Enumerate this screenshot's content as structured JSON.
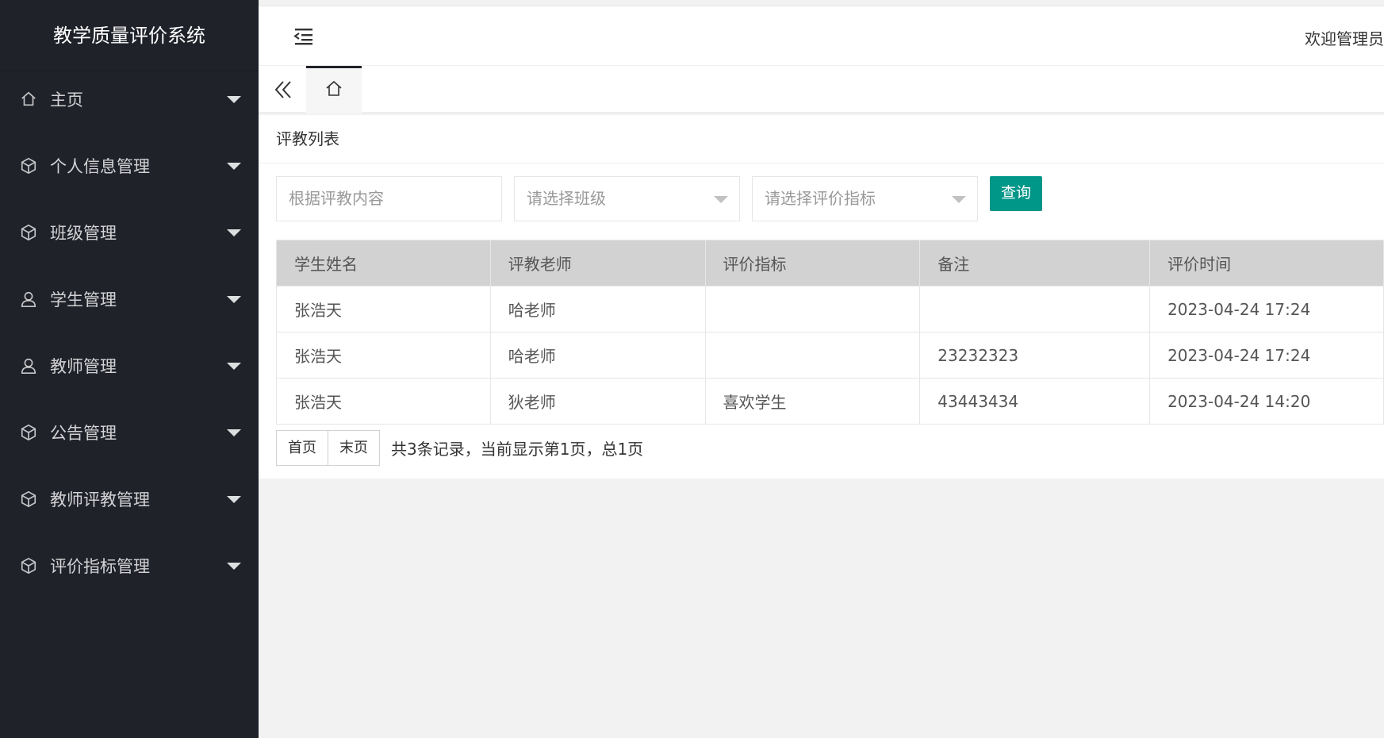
{
  "app_title": "教学质量评价系统",
  "sidebar": {
    "items": [
      {
        "label": "主页",
        "icon": "home-icon"
      },
      {
        "label": "个人信息管理",
        "icon": "cube-icon"
      },
      {
        "label": "班级管理",
        "icon": "cube-icon"
      },
      {
        "label": "学生管理",
        "icon": "user-icon"
      },
      {
        "label": "教师管理",
        "icon": "user-icon"
      },
      {
        "label": "公告管理",
        "icon": "cube-icon"
      },
      {
        "label": "教师评教管理",
        "icon": "cube-icon"
      },
      {
        "label": "评价指标管理",
        "icon": "cube-icon"
      }
    ]
  },
  "header": {
    "welcome": "欢迎管理员"
  },
  "tabs": {
    "home_icon": "home-icon",
    "back_icon": "double-chevron-left-icon"
  },
  "main": {
    "title": "评教列表",
    "search": {
      "placeholder": "根据评教内容"
    },
    "class_select": {
      "placeholder": "请选择班级"
    },
    "indicator_select": {
      "placeholder": "请选择评价指标"
    },
    "query_label": "查询",
    "table": {
      "headers": [
        "学生姓名",
        "评教老师",
        "评价指标",
        "备注",
        "评价时间"
      ],
      "rows": [
        [
          "张浩天",
          "哈老师",
          "",
          "",
          "2023-04-24 17:24"
        ],
        [
          "张浩天",
          "哈老师",
          "",
          "23232323",
          "2023-04-24 17:24"
        ],
        [
          "张浩天",
          "狄老师",
          "喜欢学生",
          "43443434",
          "2023-04-24 14:20"
        ]
      ]
    },
    "pager": {
      "first_label": "首页",
      "last_label": "末页",
      "info": "共3条记录，当前显示第1页，总1页"
    }
  },
  "colors": {
    "sidebar_bg": "#20222a",
    "accent": "#009688",
    "table_header_bg": "#d2d2d2"
  }
}
